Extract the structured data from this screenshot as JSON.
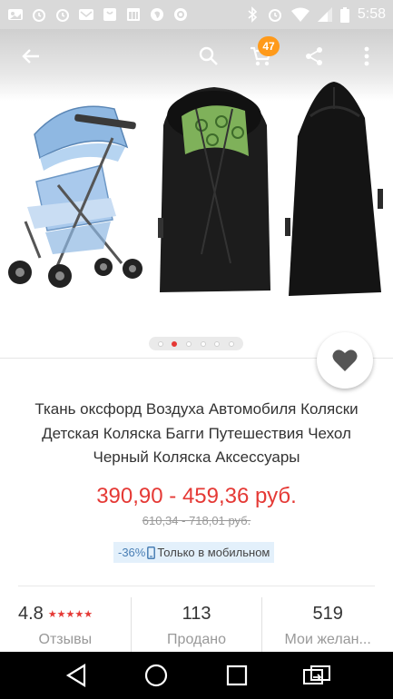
{
  "status_bar": {
    "time": "5:58",
    "left_icons": [
      "photo-icon",
      "alarm-icon",
      "mail-icon",
      "bag-icon",
      "calendar-icon",
      "app-icon",
      "lion-icon"
    ],
    "right_icons": [
      "bluetooth-icon",
      "alarm-icon",
      "wifi-icon",
      "signal-icon",
      "battery-icon"
    ]
  },
  "toolbar": {
    "back_icon": "arrow-left-icon",
    "search_icon": "search-icon",
    "cart_icon": "cart-icon",
    "cart_count": "47",
    "share_icon": "share-icon",
    "more_icon": "more-vert-icon"
  },
  "gallery": {
    "image_count": 6,
    "active_index": 1
  },
  "product": {
    "title": "Ткань оксфорд Воздуха Автомобиля Коляски Детская Коляска Багги Путешествия Чехол Черный Коляска Аксессуары",
    "price": "390,90 - 459,36 руб.",
    "old_price": "610,34 - 718,01 руб.",
    "discount": "-36%",
    "mobile_only": "Только в мобильном"
  },
  "stats": {
    "rating": "4.8",
    "stars": "★★★★★",
    "reviews_label": "Отзывы",
    "sold": "113",
    "sold_label": "Продано",
    "wishlist": "519",
    "wishlist_label": "Мои желан..."
  },
  "colors": {
    "accent_red": "#e53935",
    "badge_orange": "#ff9a1a",
    "mobile_badge_bg": "#e3f0fb"
  },
  "nav": {
    "back": "back-triangle-icon",
    "home": "home-circle-icon",
    "recents": "recents-square-icon",
    "switch": "switch-app-icon"
  }
}
